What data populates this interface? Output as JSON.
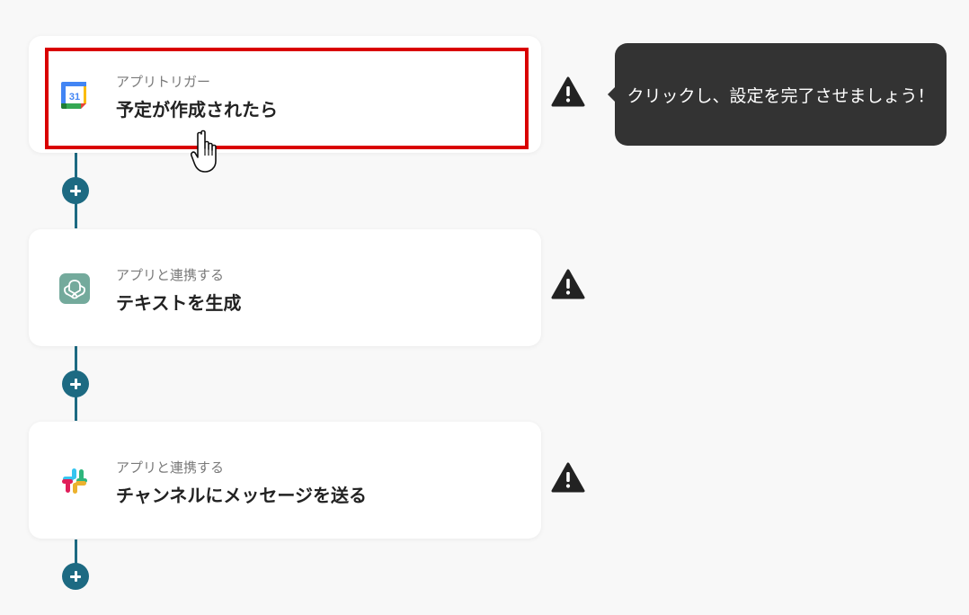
{
  "flow": {
    "steps": [
      {
        "type_label": "アプリトリガー",
        "title": "予定が作成されたら",
        "app_icon": "google-calendar-icon",
        "icon_text": "31",
        "status_icon": "warning-icon"
      },
      {
        "type_label": "アプリと連携する",
        "title": "テキストを生成",
        "app_icon": "chatgpt-icon",
        "status_icon": "warning-icon"
      },
      {
        "type_label": "アプリと連携する",
        "title": "チャンネルにメッセージを送る",
        "app_icon": "slack-icon",
        "status_icon": "warning-icon"
      }
    ],
    "add_button_icon": "plus-icon"
  },
  "tooltip": {
    "text": "クリックし、設定を完了させましょう！"
  },
  "colors": {
    "background": "#f8f8f8",
    "connector": "#1d6a82",
    "highlight": "#d90000",
    "tooltip_bg": "#333333",
    "warning": "#222222"
  }
}
